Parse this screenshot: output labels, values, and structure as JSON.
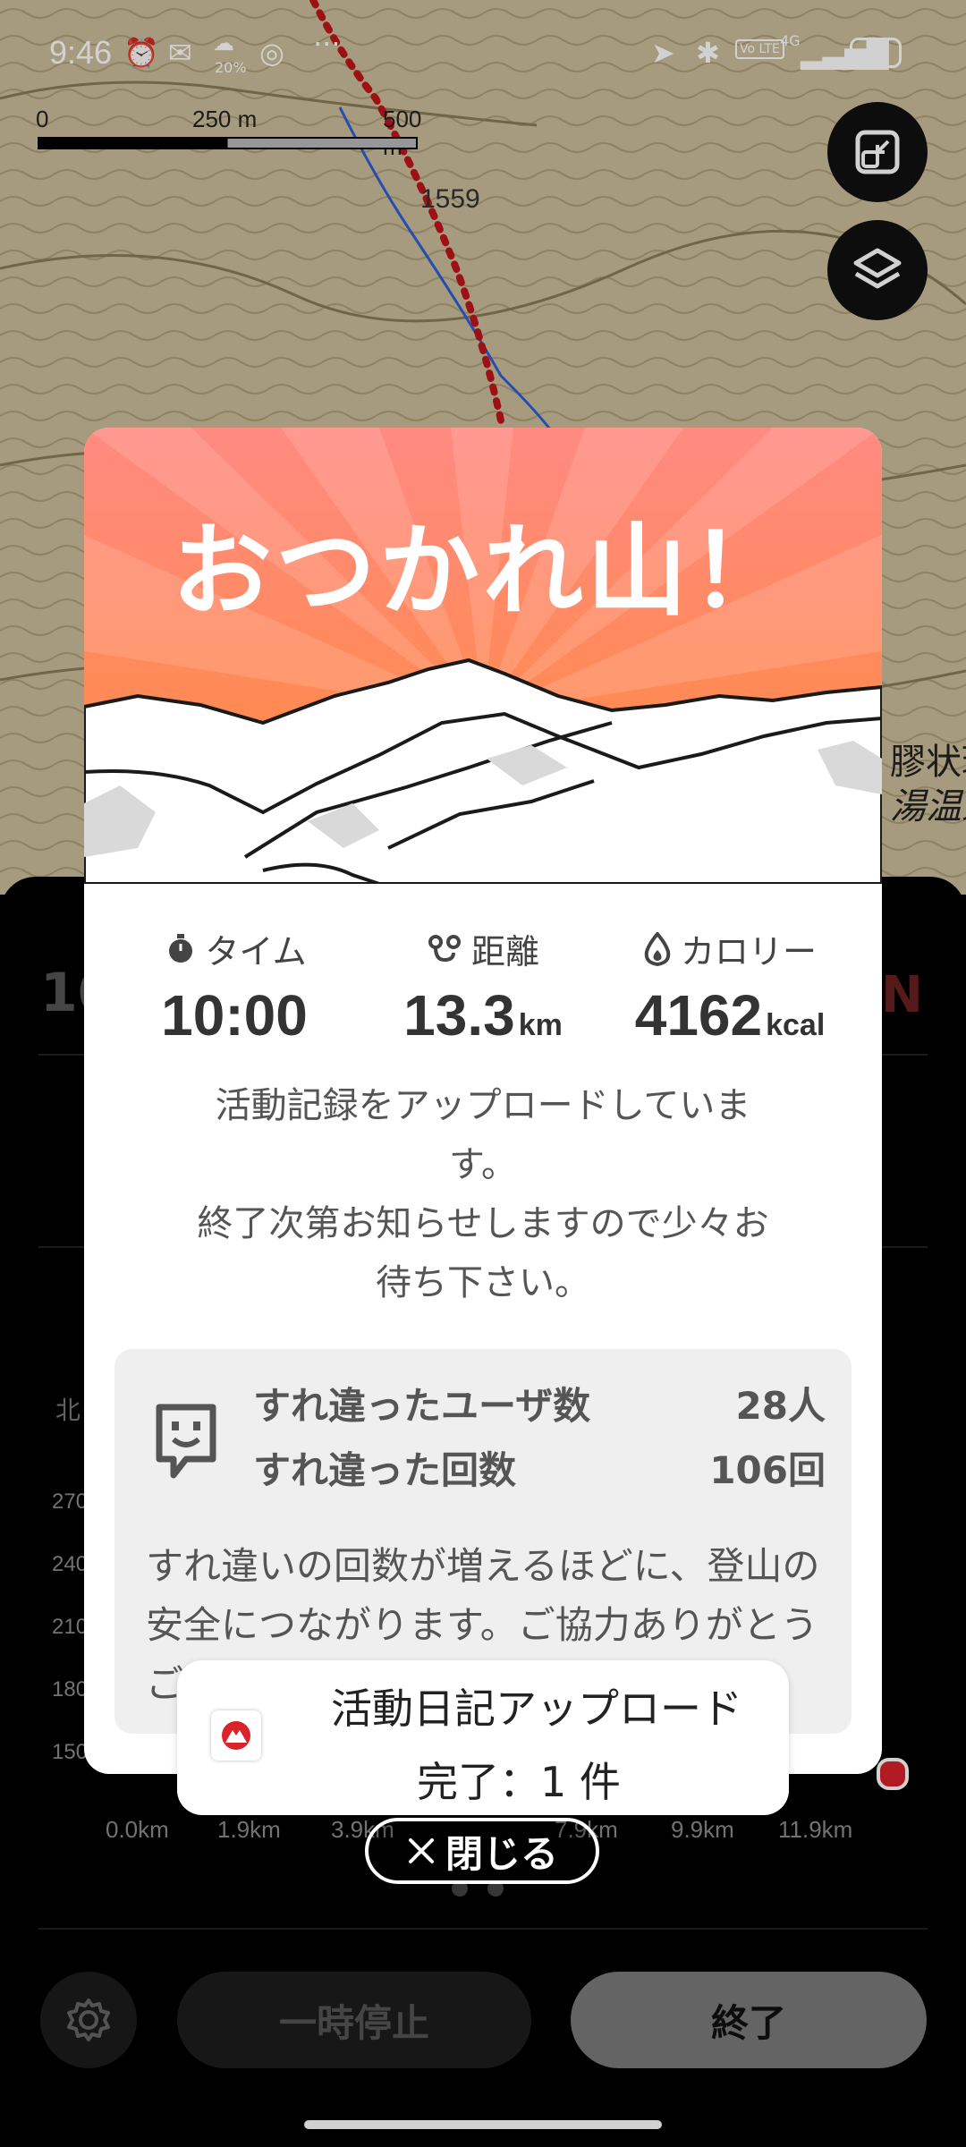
{
  "status_bar": {
    "time": "9:46",
    "weather_pct": "20%",
    "network": "4G",
    "volte": "Vo LTE",
    "battery": "62"
  },
  "map": {
    "scale_labels": [
      "0",
      "250 m",
      "500 m"
    ],
    "elevation_label": "1559",
    "place_label_1": "膠状瑶",
    "place_label_2": "湯温泉",
    "icons": [
      "fit-bounds-icon",
      "layers-icon"
    ]
  },
  "background_panel": {
    "y_labels": [
      "270",
      "240",
      "210",
      "180",
      "150"
    ],
    "x_labels": [
      "0.0km",
      "1.9km",
      "3.9km",
      "7.9km",
      "9.9km",
      "11.9km"
    ],
    "north_label": "北",
    "pause_label": "一時停止",
    "end_label": "終了"
  },
  "modal": {
    "title": "おつかれ山！",
    "stats": [
      {
        "icon": "stopwatch-icon",
        "label": "タイム",
        "value": "10:00",
        "unit": ""
      },
      {
        "icon": "route-icon",
        "label": "距離",
        "value": "13.3",
        "unit": "km"
      },
      {
        "icon": "flame-icon",
        "label": "カロリー",
        "value": "4162",
        "unit": "kcal"
      }
    ],
    "message_line1": "活動記録をアップロードしていま",
    "message_line2": "す。",
    "message_line3": "終了次第お知らせしますので少々お",
    "message_line4": "待ち下さい。",
    "passing": {
      "users_label": "すれ違ったユーザ数",
      "users_value": "28人",
      "count_label": "すれ違った回数",
      "count_value": "106回",
      "note": "すれ違いの回数が増えるほどに、登山の安全につながります。ご協力ありがとうございます。"
    }
  },
  "toast": {
    "line1": "活動日記アップロード",
    "line2": "完了：1 件"
  },
  "close_button": {
    "label": "閉じる"
  },
  "colors": {
    "header_top": "#ff8a82",
    "header_bottom": "#ff8a3a",
    "accent_red": "#d9222a"
  }
}
